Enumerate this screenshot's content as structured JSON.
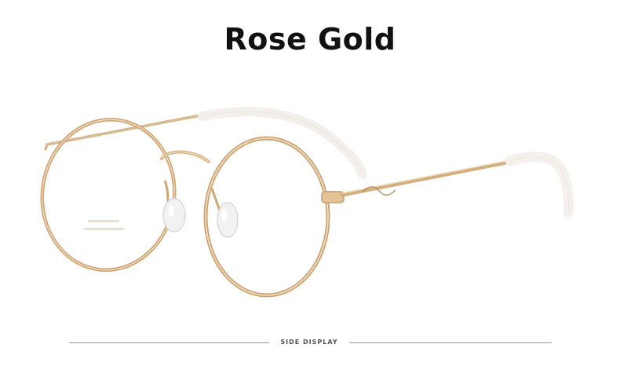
{
  "product": {
    "color_name": "Rose Gold",
    "view_caption": "SIDE DISPLAY"
  },
  "colors": {
    "frame": "#e7c9a0",
    "frame_shadow": "#c9a06c",
    "tip": "#f6f3ef",
    "nose_pad": "#eeeeee",
    "title_text": "#111111",
    "divider": "#9a9a9a"
  },
  "image": {
    "subject": "round-glasses-frame-icon"
  }
}
